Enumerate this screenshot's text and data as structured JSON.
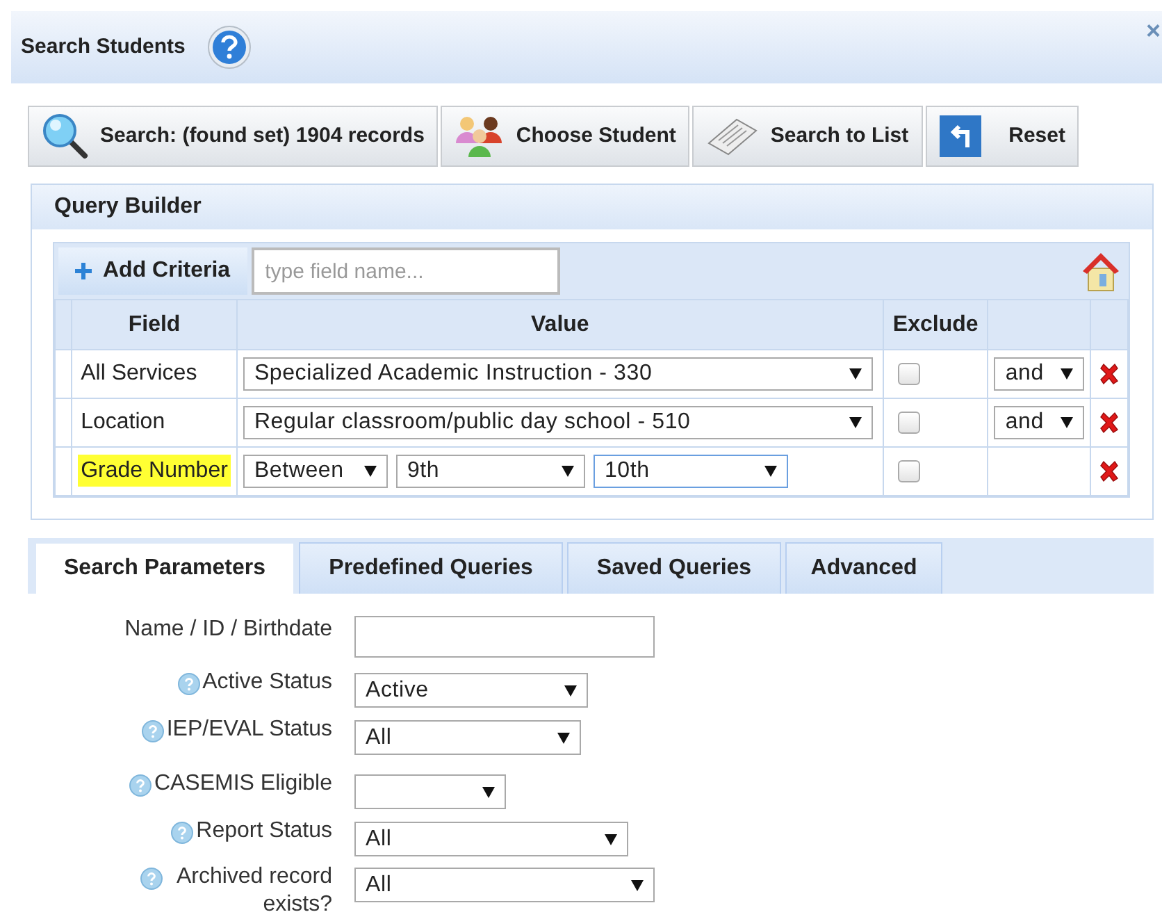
{
  "window": {
    "title": "Search Students",
    "close": "×"
  },
  "toolbar": [
    {
      "kind": "search",
      "label": "Search: (found set) 1904 records"
    },
    {
      "kind": "people",
      "label": "Choose Student"
    },
    {
      "kind": "list",
      "label": "Search to List"
    },
    {
      "kind": "reset",
      "label": "Reset"
    }
  ],
  "query_builder": {
    "title": "Query Builder",
    "add_label": "Add Criteria",
    "field_search": {
      "placeholder": "type field name..."
    },
    "columns": [
      "Field",
      "Value",
      "Exclude"
    ],
    "rows": [
      {
        "field": "All Services",
        "highlighted": false,
        "kind": "select",
        "value": "Specialized Academic Instruction - 330",
        "exclude": false,
        "connector": "and"
      },
      {
        "field": "Location",
        "highlighted": false,
        "kind": "select",
        "value": "Regular classroom/public day school - 510",
        "exclude": false,
        "connector": "and"
      },
      {
        "field": "Grade Number",
        "highlighted": true,
        "kind": "between",
        "operator": "Between",
        "from": "9th",
        "to": "10th",
        "to_focused": true,
        "exclude": false
      }
    ]
  },
  "tabs": [
    {
      "label": "Search Parameters",
      "selected": true
    },
    {
      "label": "Predefined Queries",
      "selected": false
    },
    {
      "label": "Saved Queries",
      "selected": false
    },
    {
      "label": "Advanced",
      "selected": false
    }
  ],
  "parameters": [
    {
      "label": "Name / ID / Birthdate",
      "help": false,
      "kind": "text"
    },
    {
      "label": "Active Status",
      "help": true,
      "kind": "select",
      "value": "Active"
    },
    {
      "label": "IEP/EVAL Status",
      "help": true,
      "kind": "select",
      "value": "All"
    },
    {
      "label": "CASEMIS Eligible",
      "help": true,
      "kind": "select"
    },
    {
      "label": "Report Status",
      "help": true,
      "kind": "select",
      "value": "All"
    },
    {
      "label": "Archived record exists?",
      "help": true,
      "kind": "select",
      "value": "All"
    }
  ]
}
